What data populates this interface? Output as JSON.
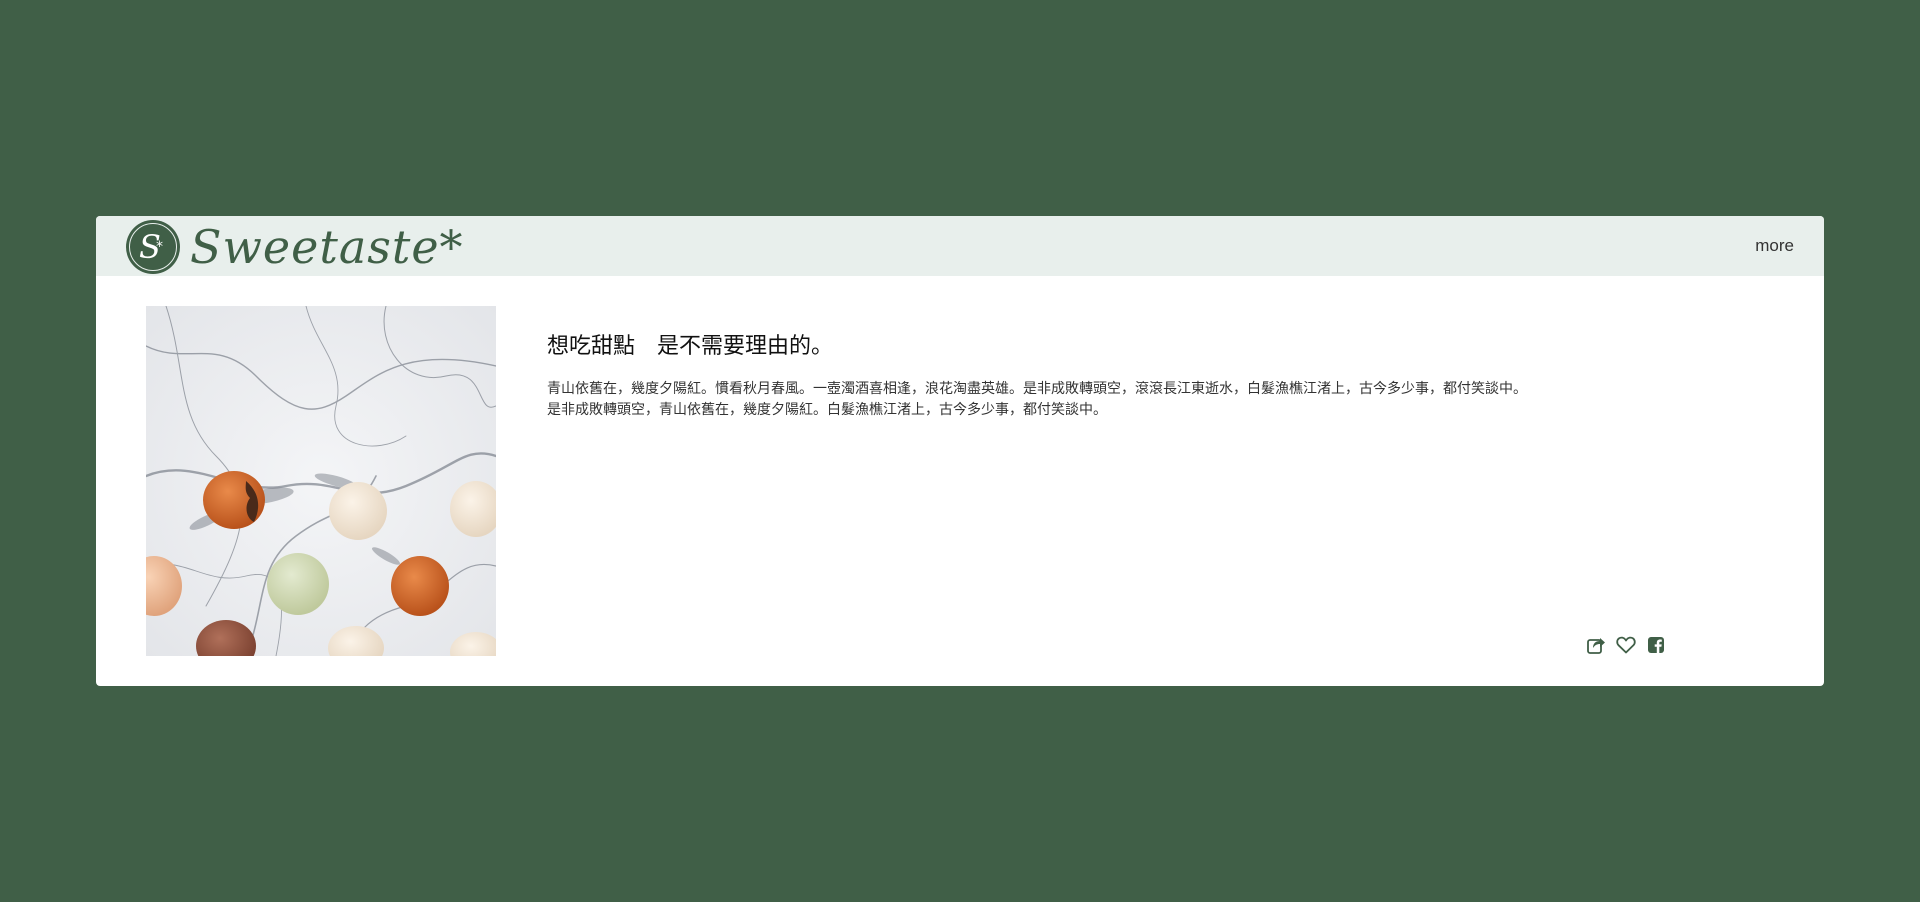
{
  "brand": {
    "name": "Sweetaste*",
    "badge_letter": "S",
    "badge_star": "*"
  },
  "nav": {
    "more_label": "more"
  },
  "article": {
    "title": "想吃甜點　是不需要理由的。",
    "lines": [
      "青山依舊在，幾度夕陽紅。慣看秋月春風。一壺濁酒喜相逢，浪花淘盡英雄。是非成敗轉頭空，滾滾長江東逝水，白髮漁樵江渚上，古今多少事，都付笑談中。",
      "是非成敗轉頭空，青山依舊在，幾度夕陽紅。白髮漁樵江渚上，古今多少事，都付笑談中。"
    ]
  },
  "actions": {
    "share_icon": "share-icon",
    "like_icon": "heart-icon",
    "facebook_icon": "facebook-icon"
  },
  "colors": {
    "background": "#405f47",
    "header": "#e8efec",
    "brand": "#405f47",
    "card": "#ffffff"
  }
}
